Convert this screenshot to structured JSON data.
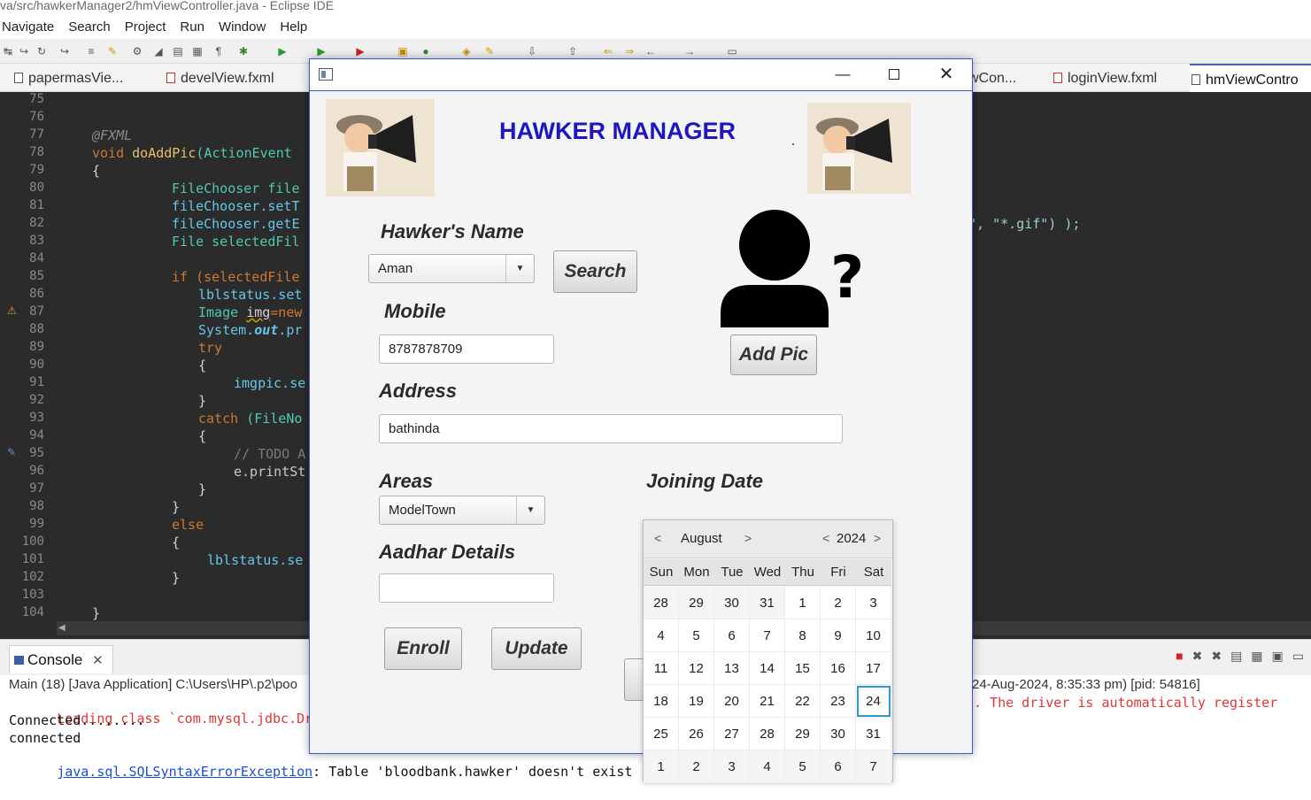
{
  "ide": {
    "title": "va/src/hawkerManager2/hmViewController.java - Eclipse IDE",
    "menu": [
      "Navigate",
      "Search",
      "Project",
      "Run",
      "Window",
      "Help"
    ],
    "tabs": [
      {
        "label": "papermasVie..."
      },
      {
        "label": "develView.fxml"
      },
      {
        "label": "wCon..."
      },
      {
        "label": "loginView.fxml"
      },
      {
        "label": "hmViewContro"
      }
    ],
    "gutter_numbers": [
      "75",
      "76",
      "77",
      "78",
      "79",
      "80",
      "81",
      "82",
      "83",
      "84",
      "85",
      "86",
      "87",
      "88",
      "89",
      "90",
      "91",
      "92",
      "93",
      "94",
      "95",
      "96",
      "97",
      "98",
      "99",
      "100",
      "101",
      "102",
      "103",
      "104"
    ],
    "code": {
      "annotation": "@FXML",
      "method_void": "void",
      "method_name": "doAddPic",
      "method_param": "(ActionEvent",
      "brace_open": "{",
      "l80": "FileChooser file",
      "l81": "fileChooser.setT",
      "l82": "fileChooser.getE",
      "l82_tail": "\", \"*.gif\") );",
      "l83": "File selectedFil",
      "l85": "if (selectedFile",
      "l86": "lblstatus.set",
      "l87a": "Image ",
      "l87b": "img",
      "l87c": "=new",
      "l88a": "System.",
      "l88b": "out",
      "l88c": ".pr",
      "l89": "try",
      "l90": "{",
      "l91": "imgpic.se",
      "l92": "}",
      "l93a": "catch ",
      "l93b": "(FileNo",
      "l94": "{",
      "l95": "// TODO A",
      "l96": "e.printSt",
      "l97": "}",
      "l98": "}",
      "l99": "else",
      "l100": "{",
      "l101": "lblstatus.se",
      "l102": "}",
      "l104": "}"
    },
    "console": {
      "tab_label": "Console",
      "close": "✕",
      "description_left": "Main (18) [Java Application] C:\\Users\\HP\\.p2\\poo",
      "description_right": "24-Aug-2024, 8:35:33 pm) [pid: 54816]",
      "line1_left": "Loading class `com.mysql.jdbc.Driv",
      "line1_right": ". The driver is automatically register",
      "line2": "Connected........",
      "line3": "connected",
      "line4_link": "java.sql.SQLSyntaxErrorException",
      "line4_rest": ": Table 'bloodbank.hawker' doesn't exist"
    }
  },
  "app": {
    "window": {
      "minimize": "—",
      "close": "✕"
    },
    "title": "HAWKER MANAGER",
    "labels": {
      "name": "Hawker's Name",
      "mobile": "Mobile",
      "address": "Address",
      "areas": "Areas",
      "joining": "Joining Date",
      "aadhar": "Aadhar Details"
    },
    "fields": {
      "name_value": "Aman",
      "mobile_value": "8787878709",
      "address_value": "bathinda",
      "areas_value": "ModelTown",
      "aadhar_value": "",
      "date_value": ""
    },
    "buttons": {
      "search": "Search",
      "add_pic": "Add Pic",
      "enroll": "Enroll",
      "update": "Update"
    },
    "calendar": {
      "month": "August",
      "year": "2024",
      "weekdays": [
        "Sun",
        "Mon",
        "Tue",
        "Wed",
        "Thu",
        "Fri",
        "Sat"
      ],
      "weeks": [
        [
          "28",
          "29",
          "30",
          "31",
          "1",
          "2",
          "3"
        ],
        [
          "4",
          "5",
          "6",
          "7",
          "8",
          "9",
          "10"
        ],
        [
          "11",
          "12",
          "13",
          "14",
          "15",
          "16",
          "17"
        ],
        [
          "18",
          "19",
          "20",
          "21",
          "22",
          "23",
          "24"
        ],
        [
          "25",
          "26",
          "27",
          "28",
          "29",
          "30",
          "31"
        ],
        [
          "1",
          "2",
          "3",
          "4",
          "5",
          "6",
          "7"
        ]
      ],
      "selected": "24"
    }
  }
}
